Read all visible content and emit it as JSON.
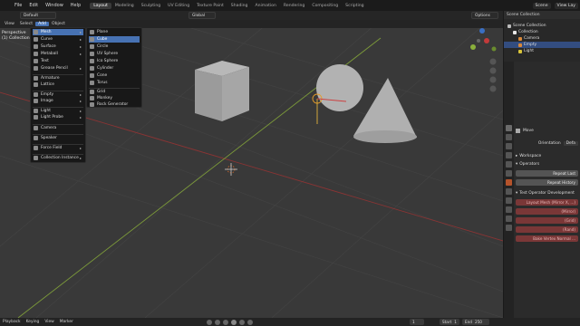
{
  "topbar": {
    "menus": [
      "File",
      "Edit",
      "Window",
      "Help"
    ],
    "workspaces": [
      "Layout",
      "Modeling",
      "Sculpting",
      "UV Editing",
      "Texture Paint",
      "Shading",
      "Animation",
      "Rendering",
      "Compositing",
      "Scripting"
    ],
    "active_workspace": "Layout",
    "scene_label": "Scene",
    "view_layer_label": "View Lay"
  },
  "viewport_header": {
    "mode": "Object Mode",
    "menus": [
      "View",
      "Select",
      "Add",
      "Object"
    ],
    "active_menu": "Add",
    "orientation_label": "Global",
    "workspace_short": "Default",
    "options_label": "Options"
  },
  "viewport_overlay": {
    "line1": "Perspective",
    "line2": "(1) Collection | Empty"
  },
  "add_menu": {
    "items": [
      {
        "label": "Mesh",
        "icon": "mesh-icon",
        "submenu": true,
        "highlight": true
      },
      {
        "label": "Curve",
        "icon": "curve-icon",
        "submenu": true
      },
      {
        "label": "Surface",
        "icon": "surface-icon",
        "submenu": true
      },
      {
        "label": "Metaball",
        "icon": "metaball-icon",
        "submenu": true
      },
      {
        "label": "Text",
        "icon": "text-icon",
        "submenu": false
      },
      {
        "label": "Grease Pencil",
        "icon": "grease-pencil-icon",
        "submenu": true
      },
      {
        "label": "Armature",
        "icon": "armature-icon",
        "submenu": false
      },
      {
        "label": "Lattice",
        "icon": "lattice-icon",
        "submenu": false
      },
      {
        "label": "Empty",
        "icon": "empty-icon",
        "submenu": true
      },
      {
        "label": "Image",
        "icon": "image-icon",
        "submenu": true
      },
      {
        "label": "Light",
        "icon": "light-icon",
        "submenu": true
      },
      {
        "label": "Light Probe",
        "icon": "light-probe-icon",
        "submenu": true
      },
      {
        "label": "Camera",
        "icon": "camera-icon",
        "submenu": false
      },
      {
        "label": "Speaker",
        "icon": "speaker-icon",
        "submenu": false
      },
      {
        "label": "Force Field",
        "icon": "force-field-icon",
        "submenu": true
      },
      {
        "label": "Collection Instance",
        "icon": "collection-instance-icon",
        "submenu": true
      }
    ]
  },
  "mesh_menu": {
    "items": [
      {
        "label": "Plane",
        "icon": "plane-icon"
      },
      {
        "label": "Cube",
        "icon": "cube-icon",
        "highlight": true
      },
      {
        "label": "Circle",
        "icon": "circle-icon"
      },
      {
        "label": "UV Sphere",
        "icon": "uv-sphere-icon"
      },
      {
        "label": "Ico Sphere",
        "icon": "ico-sphere-icon"
      },
      {
        "label": "Cylinder",
        "icon": "cylinder-icon"
      },
      {
        "label": "Cone",
        "icon": "cone-icon"
      },
      {
        "label": "Torus",
        "icon": "torus-icon"
      },
      {
        "label": "Grid",
        "icon": "grid-icon"
      },
      {
        "label": "Monkey",
        "icon": "monkey-icon"
      },
      {
        "label": "Rock Generator",
        "icon": "rock-icon"
      }
    ]
  },
  "outliner": {
    "title": "Scene Collection",
    "rows": [
      {
        "label": "Scene Collection",
        "indent": 0,
        "color": "#bbbbbb"
      },
      {
        "label": "Collection",
        "indent": 1,
        "color": "#e6e6e6"
      },
      {
        "label": "Camera",
        "indent": 2,
        "color": "#d9893a"
      },
      {
        "label": "Empty",
        "indent": 2,
        "color": "#d9893a",
        "selected": true
      },
      {
        "label": "Light",
        "indent": 2,
        "color": "#d9c53a"
      }
    ]
  },
  "properties": {
    "tool_name": "Move",
    "orientation_label": "Orientation",
    "orientation_value": "Defa",
    "workspace_panel": "Workspace",
    "operators_panel": "Operators",
    "buttons": [
      "Repeat Last",
      "Repeat History"
    ],
    "test_panel": "Test Operator Development",
    "test_buttons": [
      "Layout Mesh (Mirror X, ...)",
      "(Mirror)",
      "(Grid)",
      "(Rand)",
      "Bake Vertex Normal ..."
    ]
  },
  "timeline": {
    "playback_label": "Playback",
    "view_label": "View",
    "marker_label": "Marker",
    "current_frame": "1",
    "start_label": "Start",
    "start_value": "1",
    "end_label": "End",
    "end_value": "250",
    "keying_label": "Keying"
  },
  "colors": {
    "accent": "#4772b3",
    "x_axis": "#c33a3a",
    "y_axis": "#8bb03b",
    "z_axis": "#3a6fc3"
  }
}
